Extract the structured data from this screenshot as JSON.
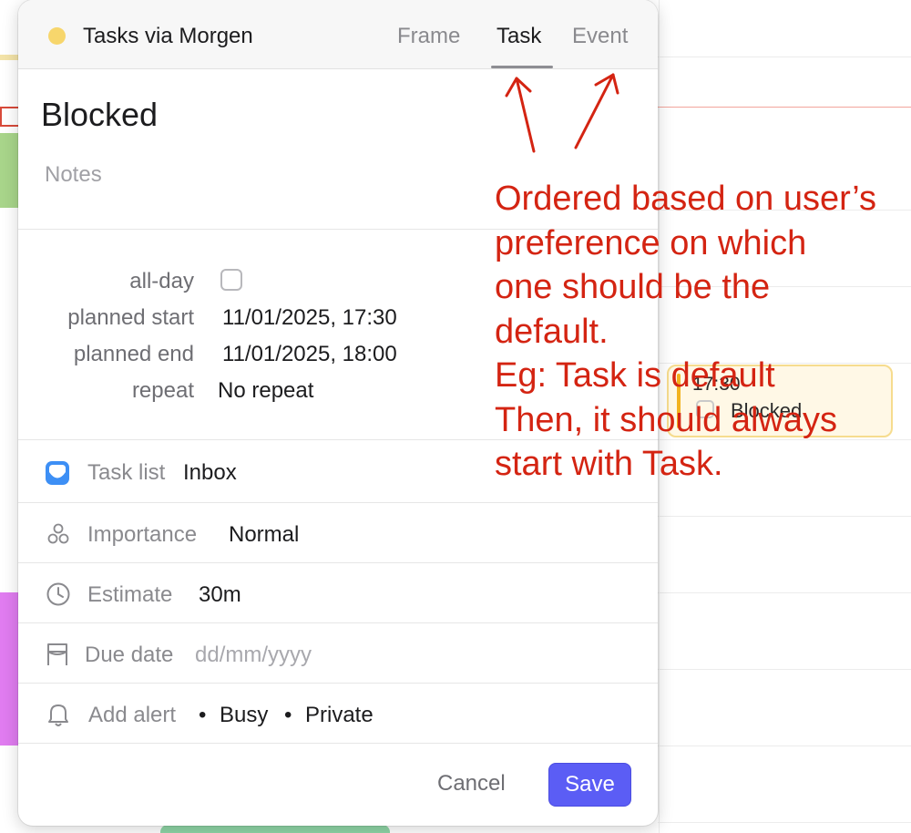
{
  "popover": {
    "calendar_name": "Tasks via Morgen",
    "calendar_color": "#f7d66c",
    "tabs": [
      {
        "label": "Frame",
        "active": false
      },
      {
        "label": "Task",
        "active": true
      },
      {
        "label": "Event",
        "active": false
      }
    ],
    "title": "Blocked",
    "notes_placeholder": "Notes",
    "details": {
      "allday_label": "all-day",
      "allday_checked": false,
      "planned_start_label": "planned start",
      "planned_start_value": "11/01/2025, 17:30",
      "planned_end_label": "planned end",
      "planned_end_value": "11/01/2025, 18:00",
      "repeat_label": "repeat",
      "repeat_value": "No repeat"
    },
    "task_list": {
      "label": "Task list",
      "value": "Inbox",
      "icon": "inbox-icon"
    },
    "importance": {
      "label": "Importance",
      "value": "Normal",
      "icon": "importance-icon"
    },
    "estimate": {
      "label": "Estimate",
      "value": "30m",
      "icon": "clock-icon"
    },
    "due_date": {
      "label": "Due date",
      "placeholder": "dd/mm/yyyy",
      "icon": "flag-icon"
    },
    "alert": {
      "label": "Add alert",
      "busy": "Busy",
      "privacy": "Private",
      "separator": "•",
      "icon": "bell-icon"
    },
    "buttons": {
      "cancel": "Cancel",
      "save": "Save"
    },
    "accent_color": "#5b5df5"
  },
  "background_event": {
    "time": "17:30",
    "title": "Blocked",
    "color": "#f2b21f"
  },
  "annotation": {
    "color": "#d42412",
    "lines": [
      "Ordered based on user’s",
      "preference on which",
      "one should be the",
      "default.",
      "Eg: Task is default",
      "Then, it should always",
      "start with Task."
    ]
  }
}
